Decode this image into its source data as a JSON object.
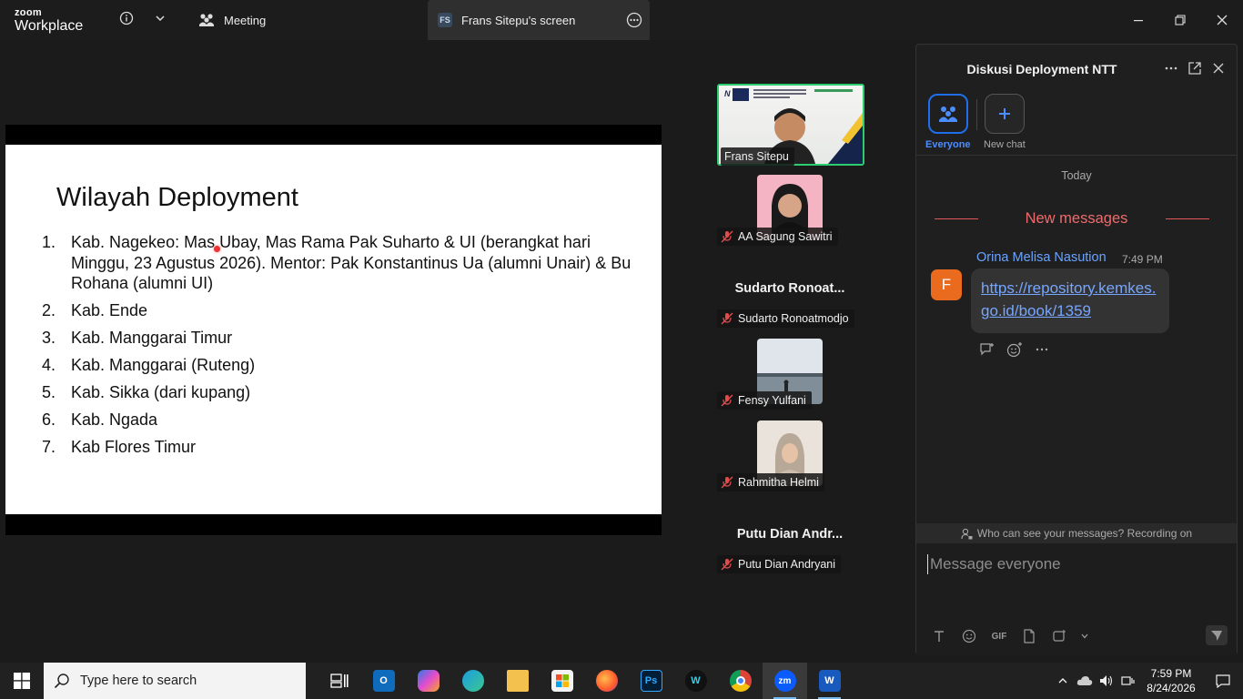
{
  "app": {
    "brand_top": "zoom",
    "brand_bottom": "Workplace"
  },
  "tabs": {
    "meeting": "Meeting",
    "screen_badge": "FS",
    "screen": "Frans Sitepu's screen"
  },
  "slide": {
    "title": "Wilayah Deployment",
    "items": [
      {
        "num": "1.",
        "text": "Kab. Nagekeo: Mas Ubay, Mas Rama Pak Suharto & UI (berangkat hari Minggu, 23 Agustus 2026). Mentor: Pak Konstantinus Ua (alumni Unair) & Bu Rohana (alumni UI)"
      },
      {
        "num": "2.",
        "text": "Kab. Ende"
      },
      {
        "num": "3.",
        "text": "Kab. Manggarai Timur"
      },
      {
        "num": "4.",
        "text": "Kab. Manggarai (Ruteng)"
      },
      {
        "num": "5.",
        "text": "Kab. Sikka (dari kupang)"
      },
      {
        "num": "6.",
        "text": "Kab. Ngada"
      },
      {
        "num": "7.",
        "text": "Kab  Flores Timur"
      }
    ]
  },
  "participants": [
    {
      "name": "Frans Sitepu",
      "active_speaker": true,
      "video": "camera"
    },
    {
      "name": "AA Sagung Sawitri",
      "video": "photo"
    },
    {
      "name": "Sudarto Ronoatmodjo",
      "display_name": "Sudarto  Ronoat...",
      "video": "none"
    },
    {
      "name": "Fensy Yulfani",
      "video": "photo"
    },
    {
      "name": "Rahmitha Helmi",
      "video": "photo"
    },
    {
      "name": "Putu Dian Andryani",
      "display_name": "Putu Dian Andr...",
      "video": "none"
    }
  ],
  "chat": {
    "title": "Diskusi Deployment NTT",
    "channels": [
      {
        "label": "Everyone",
        "selected": true
      },
      {
        "label": "New chat",
        "selected": false
      }
    ],
    "date_divider": "Today",
    "new_messages_label": "New messages",
    "message": {
      "sender": "Orina Melisa Nasution",
      "time": "7:49 PM",
      "avatar_letter": "F",
      "link": "https://repository.kemkes.go.id/book/1359"
    },
    "privacy_note": "Who can see your messages? Recording on",
    "input_placeholder": "Message everyone",
    "tools": {
      "gif": "GIF"
    }
  },
  "taskbar": {
    "search_placeholder": "Type here to search",
    "apps": [
      "task-view",
      "outlook",
      "copilot",
      "edge",
      "file-explorer",
      "microsoft-store",
      "firefox",
      "photoshop",
      "webex",
      "chrome",
      "zoom",
      "word"
    ],
    "active_app": "zoom",
    "clock_time": "7:59 PM",
    "clock_date": "8/24/2026"
  },
  "colors": {
    "active_speaker_border": "#2ecc71",
    "link": "#76a6ff",
    "new_messages": "#ee6b6d",
    "channel_selected": "#1f6feb",
    "avatar": "#ea6a1e"
  }
}
